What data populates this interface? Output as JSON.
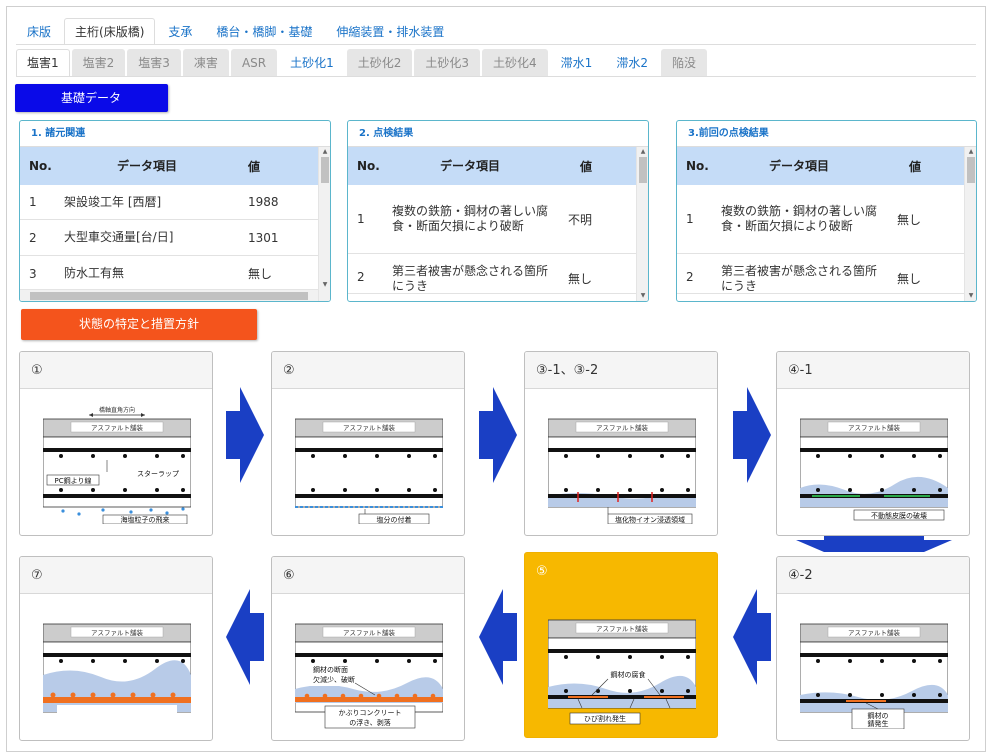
{
  "main_tabs": [
    {
      "label": "床版",
      "state": "normal"
    },
    {
      "label": "主桁(床版橋)",
      "state": "active"
    },
    {
      "label": "支承",
      "state": "normal"
    },
    {
      "label": "橋台・橋脚・基礎",
      "state": "normal"
    },
    {
      "label": "伸縮装置・排水装置",
      "state": "normal"
    }
  ],
  "sub_tabs": [
    {
      "label": "塩害1",
      "state": "active"
    },
    {
      "label": "塩害2",
      "state": "disabled"
    },
    {
      "label": "塩害3",
      "state": "disabled"
    },
    {
      "label": "凍害",
      "state": "disabled"
    },
    {
      "label": "ASR",
      "state": "disabled"
    },
    {
      "label": "土砂化1",
      "state": "normal"
    },
    {
      "label": "土砂化2",
      "state": "disabled"
    },
    {
      "label": "土砂化3",
      "state": "disabled"
    },
    {
      "label": "土砂化4",
      "state": "disabled"
    },
    {
      "label": "滞水1",
      "state": "normal"
    },
    {
      "label": "滞水2",
      "state": "normal"
    },
    {
      "label": "陥没",
      "state": "disabled"
    }
  ],
  "kiso_button": "基礎データ",
  "joutai_button": "状態の特定と措置方針",
  "panels": [
    {
      "title": "1. 諸元関連",
      "headers": {
        "no": "No.",
        "item": "データ項目",
        "value": "値"
      },
      "rows": [
        {
          "no": "1",
          "item": "架設竣工年 [西暦]",
          "value": "1988"
        },
        {
          "no": "2",
          "item": "大型車交通量[台/日]",
          "value": "1301"
        },
        {
          "no": "3",
          "item": "防水工有無",
          "value": "無し"
        }
      ]
    },
    {
      "title": "2. 点検結果",
      "headers": {
        "no": "No.",
        "item": "データ項目",
        "value": "値"
      },
      "rows": [
        {
          "no": "1",
          "item": "複数の鉄筋・鋼材の著しい腐食・断面欠損により破断",
          "value": "不明"
        },
        {
          "no": "2",
          "item": "第三者被害が懸念される箇所にうき",
          "value": "無し"
        }
      ]
    },
    {
      "title": "3.前回の点検結果",
      "headers": {
        "no": "No.",
        "item": "データ項目",
        "value": "値"
      },
      "rows": [
        {
          "no": "1",
          "item": "複数の鉄筋・鋼材の著しい腐食・断面欠損により破断",
          "value": "無し"
        },
        {
          "no": "2",
          "item": "第三者被害が懸念される箇所にうき",
          "value": "無し"
        }
      ]
    }
  ],
  "stages": [
    {
      "title": "①",
      "highlight": false,
      "diagram": {
        "pavement": "アスファルト舗装",
        "top_label": "橋軸直角方向",
        "labels": [
          "スターラップ",
          "PC鋼より線",
          "海塩粒子の飛来"
        ]
      }
    },
    {
      "title": "②",
      "highlight": false,
      "diagram": {
        "pavement": "アスファルト舗装",
        "labels": [
          "塩分の付着"
        ]
      }
    },
    {
      "title": "③-1、③-2",
      "highlight": false,
      "diagram": {
        "pavement": "アスファルト舗装",
        "labels": [
          "塩化物イオン浸透領域"
        ]
      }
    },
    {
      "title": "④-1",
      "highlight": false,
      "diagram": {
        "pavement": "アスファルト舗装",
        "labels": [
          "不動態皮膜の破壊"
        ]
      }
    },
    {
      "title": "⑦",
      "highlight": false,
      "diagram": {
        "pavement": "アスファルト舗装",
        "labels": []
      }
    },
    {
      "title": "⑥",
      "highlight": false,
      "diagram": {
        "pavement": "アスファルト舗装",
        "labels": [
          "鋼材の断面",
          "欠減少、破断",
          "かぶりコンクリート",
          "の浮き、剥落"
        ]
      }
    },
    {
      "title": "⑤",
      "highlight": true,
      "diagram": {
        "pavement": "アスファルト舗装",
        "labels": [
          "鋼材の腐食",
          "ひび割れ発生"
        ]
      }
    },
    {
      "title": "④-2",
      "highlight": false,
      "diagram": {
        "pavement": "アスファルト舗装",
        "labels": [
          "鋼材の",
          "錆発生"
        ]
      }
    }
  ],
  "colors": {
    "tab_link": "#1a73c8",
    "kiso_button": "#0a0ae8",
    "joutai_button": "#f4541c",
    "table_header": "#c5dcf7",
    "panel_border": "#5bb6cc",
    "highlight": "#f7b800",
    "flow_arrow": "#1a3fc4"
  },
  "icons": {
    "flow_arrow": "arrow-icon"
  }
}
